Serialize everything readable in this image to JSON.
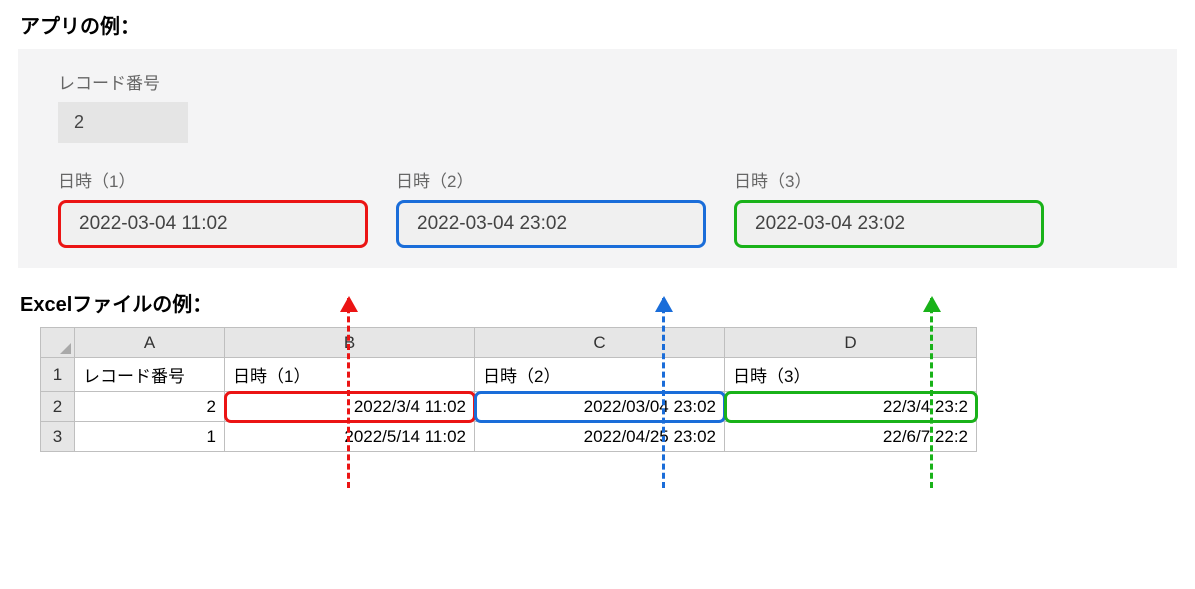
{
  "headings": {
    "app": "アプリの例：",
    "excel": "Excelファイルの例："
  },
  "app": {
    "record_label": "レコード番号",
    "record_value": "2",
    "fields": [
      {
        "label": "日時（1）",
        "value": "2022-03-04 11:02",
        "color": "red"
      },
      {
        "label": "日時（2）",
        "value": "2022-03-04 23:02",
        "color": "blue"
      },
      {
        "label": "日時（3）",
        "value": "2022-03-04 23:02",
        "color": "green"
      }
    ]
  },
  "excel": {
    "columns": [
      "A",
      "B",
      "C",
      "D"
    ],
    "header_row": [
      "レコード番号",
      "日時（1）",
      "日時（2）",
      "日時（3）"
    ],
    "rows": [
      {
        "num": "2",
        "cells": [
          "2",
          "2022/3/4 11:02",
          "2022/03/04 23:02",
          "22/3/4 23:2"
        ],
        "highlight": [
          "",
          "red",
          "blue",
          "green"
        ]
      },
      {
        "num": "3",
        "cells": [
          "1",
          "2022/5/14 11:02",
          "2022/04/25 23:02",
          "22/6/7 22:2"
        ],
        "highlight": [
          "",
          "",
          "",
          ""
        ]
      }
    ]
  },
  "annotation": {
    "colors": {
      "red": "#eb1414",
      "blue": "#1a6dd9",
      "green": "#19b219"
    }
  }
}
